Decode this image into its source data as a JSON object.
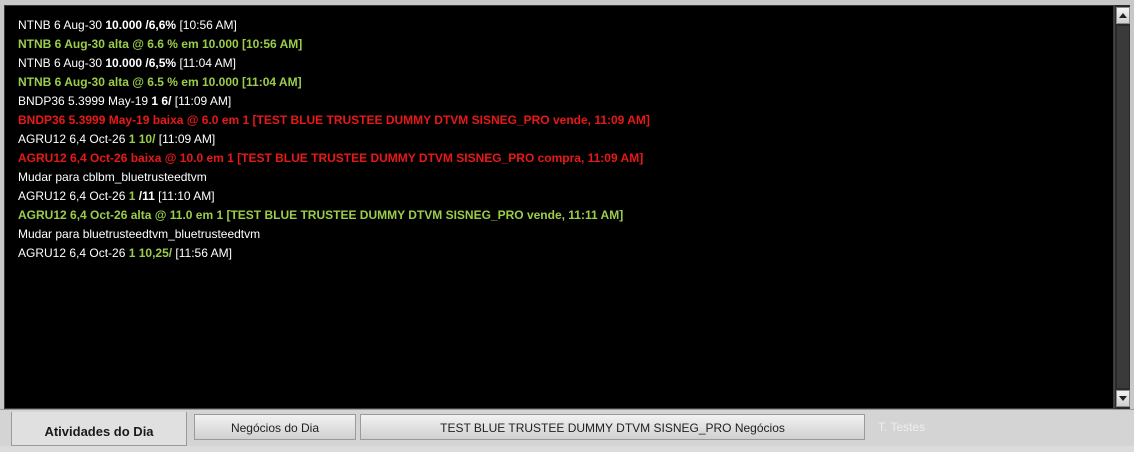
{
  "log": [
    {
      "parts": [
        {
          "t": "NTNB 6 Aug-30 ",
          "c": "white"
        },
        {
          "t": "10.000",
          "c": "b white"
        },
        {
          "t": "   /6,6%",
          "c": "b white"
        },
        {
          "t": " [10:56 AM]",
          "c": "white"
        }
      ]
    },
    {
      "parts": [
        {
          "t": "NTNB 6 Aug-30 alta @ 6.6 % em  10.000 [10:56 AM]",
          "c": "green"
        }
      ]
    },
    {
      "parts": [
        {
          "t": "NTNB 6 Aug-30 ",
          "c": "white"
        },
        {
          "t": "10.000",
          "c": "b white"
        },
        {
          "t": "   /6,5%",
          "c": "b white"
        },
        {
          "t": " [11:04 AM]",
          "c": "white"
        }
      ]
    },
    {
      "parts": [
        {
          "t": "NTNB 6 Aug-30 alta @ 6.5 % em  10.000 [11:04 AM]",
          "c": "green"
        }
      ]
    },
    {
      "parts": [
        {
          "t": "BNDP36 5.3999 May-19 ",
          "c": "white"
        },
        {
          "t": "1 6/",
          "c": "b white"
        },
        {
          "t": "   [11:09 AM]",
          "c": "white"
        }
      ]
    },
    {
      "parts": [
        {
          "t": "BNDP36 5.3999 May-19 baixa @ 6.0 em  1 [TEST BLUE TRUSTEE DUMMY DTVM SISNEG_PRO vende, 11:09 AM]",
          "c": "red"
        }
      ]
    },
    {
      "parts": [
        {
          "t": "AGRU12 6,4 Oct-26 ",
          "c": "white"
        },
        {
          "t": "1 10/",
          "c": "g"
        },
        {
          "t": "   [11:09 AM]",
          "c": "white"
        }
      ]
    },
    {
      "parts": [
        {
          "t": "AGRU12 6,4 Oct-26 baixa @ 10.0 em  1 [TEST BLUE TRUSTEE DUMMY DTVM SISNEG_PRO compra, 11:09 AM]",
          "c": "red"
        }
      ]
    },
    {
      "parts": [
        {
          "t": "Mudar para cblbm_bluetrusteedtvm",
          "c": "white"
        }
      ]
    },
    {
      "parts": [
        {
          "t": "AGRU12 6,4 Oct-26 ",
          "c": "white"
        },
        {
          "t": "1",
          "c": "g"
        },
        {
          "t": "   /11",
          "c": "b white"
        },
        {
          "t": " [11:10 AM]",
          "c": "white"
        }
      ]
    },
    {
      "parts": [
        {
          "t": "AGRU12 6,4 Oct-26 alta @ 11.0 em  1 [TEST BLUE TRUSTEE DUMMY DTVM SISNEG_PRO vende, 11:11 AM]",
          "c": "green"
        }
      ]
    },
    {
      "parts": [
        {
          "t": "Mudar para bluetrusteedtvm_bluetrusteedtvm",
          "c": "white"
        }
      ]
    },
    {
      "parts": [
        {
          "t": "AGRU12 6,4 Oct-26 ",
          "c": "white"
        },
        {
          "t": "1 10,25/",
          "c": "g"
        },
        {
          "t": "   [11:56 AM]",
          "c": "white"
        }
      ]
    }
  ],
  "tabs": {
    "activities": "Atividades do Dia",
    "deals": "Negócios do Dia",
    "trustee_deals": "TEST BLUE TRUSTEE DUMMY DTVM SISNEG_PRO Negócios",
    "tests": "T. Testes"
  },
  "icons": {
    "scroll_up": "triangle-up",
    "scroll_down": "triangle-down"
  },
  "colors": {
    "background": "#000000",
    "normal_text": "#ffffff",
    "up_text": "#9acd4a",
    "down_text": "#e81818"
  }
}
